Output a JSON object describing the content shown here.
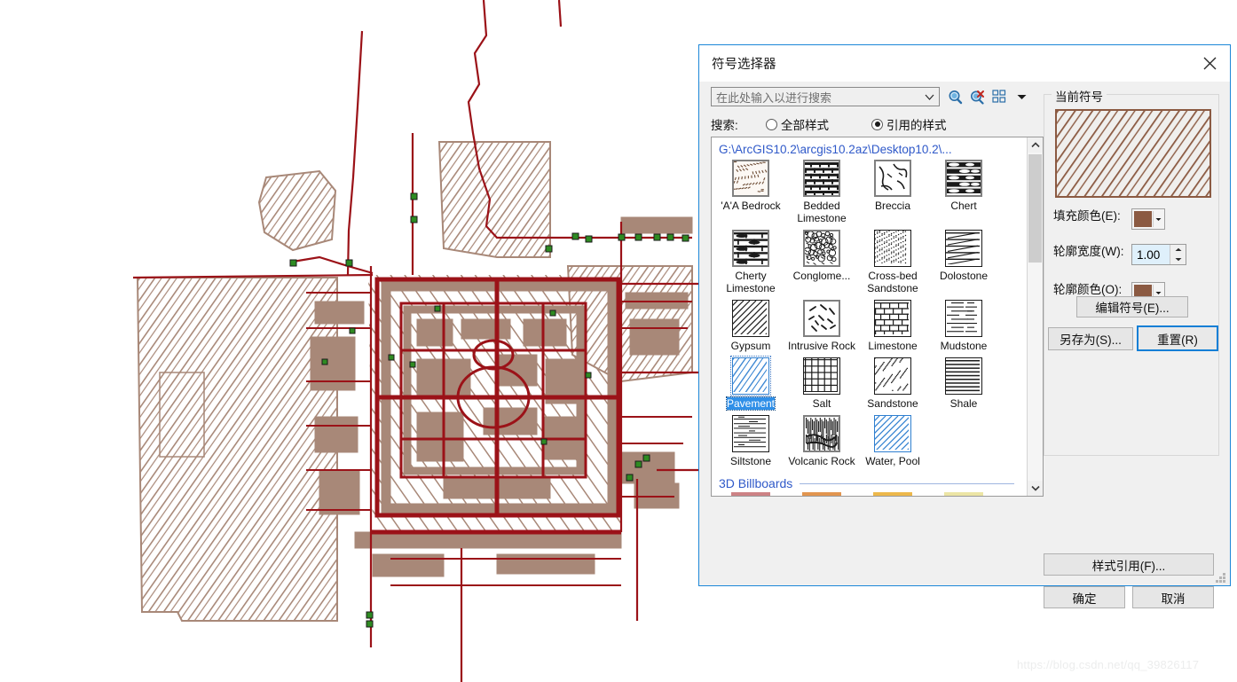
{
  "watermark": "https://blog.csdn.net/qq_39826117",
  "dialog": {
    "title": "符号选择器",
    "close_icon": "close-icon",
    "search": {
      "placeholder": "在此处输入以进行搜索",
      "dropdown_icon": "chevron-down-icon",
      "search_icon": "search-icon",
      "clear_search_icon": "clear-search-icon",
      "view_mode_icon": "grid-view-icon",
      "view_mode_arrow_icon": "chevron-down-icon",
      "label": "搜索:",
      "options": [
        {
          "label": "全部样式",
          "selected": false
        },
        {
          "label": "引用的样式",
          "selected": true
        }
      ]
    },
    "gallery": {
      "style_path": "G:\\ArcGIS10.2\\arcgis10.2az\\Desktop10.2\\...",
      "symbols": [
        {
          "label": "'A'A Bedrock",
          "pattern": "speckle-dash",
          "selected": false
        },
        {
          "label": "Bedded Limestone",
          "pattern": "brick-bedded",
          "selected": false
        },
        {
          "label": "Breccia",
          "pattern": "breccia",
          "selected": false
        },
        {
          "label": "Chert",
          "pattern": "chert",
          "selected": false
        },
        {
          "label": "Cherty Limestone",
          "pattern": "cherty",
          "selected": false
        },
        {
          "label": "Conglome...",
          "pattern": "conglomerate",
          "selected": false
        },
        {
          "label": "Cross-bed Sandstone",
          "pattern": "fine-dots",
          "selected": false
        },
        {
          "label": "Dolostone",
          "pattern": "dolostone",
          "selected": false
        },
        {
          "label": "Gypsum",
          "pattern": "diagonal",
          "selected": false
        },
        {
          "label": "Intrusive Rock",
          "pattern": "intrusive",
          "selected": false
        },
        {
          "label": "Limestone",
          "pattern": "brick-lime",
          "selected": false
        },
        {
          "label": "Mudstone",
          "pattern": "mudstone",
          "selected": false
        },
        {
          "label": "Pavement",
          "pattern": "pavement-blue",
          "selected": true
        },
        {
          "label": "Salt",
          "pattern": "grid",
          "selected": false
        },
        {
          "label": "Sandstone",
          "pattern": "sparse-dots",
          "selected": false
        },
        {
          "label": "Shale",
          "pattern": "horizontal",
          "selected": false
        },
        {
          "label": "Siltstone",
          "pattern": "siltstone",
          "selected": false
        },
        {
          "label": "Volcanic Rock",
          "pattern": "volcanic",
          "selected": false
        },
        {
          "label": "Water, Pool",
          "pattern": "water-blue",
          "selected": false
        }
      ],
      "section_title": "3D Billboards",
      "billboard_colors": [
        "#cd8285",
        "#e2954f",
        "#edb84b",
        "#ece5a5"
      ],
      "scroll_up_icon": "chevron-up-icon",
      "scroll_down_icon": "chevron-down-icon"
    },
    "current_symbol": {
      "group_title": "当前符号",
      "preview_fill": "#8b5a42",
      "preview_bg": "#f0efed",
      "fill_color_label": "填充颜色(E):",
      "fill_color": "#8b5a42",
      "outline_width_label": "轮廓宽度(W):",
      "outline_width": "1.00",
      "outline_color_label": "轮廓颜色(O):",
      "outline_color": "#8b5a42",
      "edit_symbol_label": "编辑符号(E)...",
      "save_as_label": "另存为(S)...",
      "reset_label": "重置(R)"
    },
    "buttons": {
      "style_reference": "样式引用(F)...",
      "ok": "确定",
      "cancel": "取消"
    }
  },
  "map": {
    "line_color": "#9b1218",
    "polygon_color": "#a88878",
    "hatch_color": "#a88878",
    "point_color": "#2e8b22"
  }
}
